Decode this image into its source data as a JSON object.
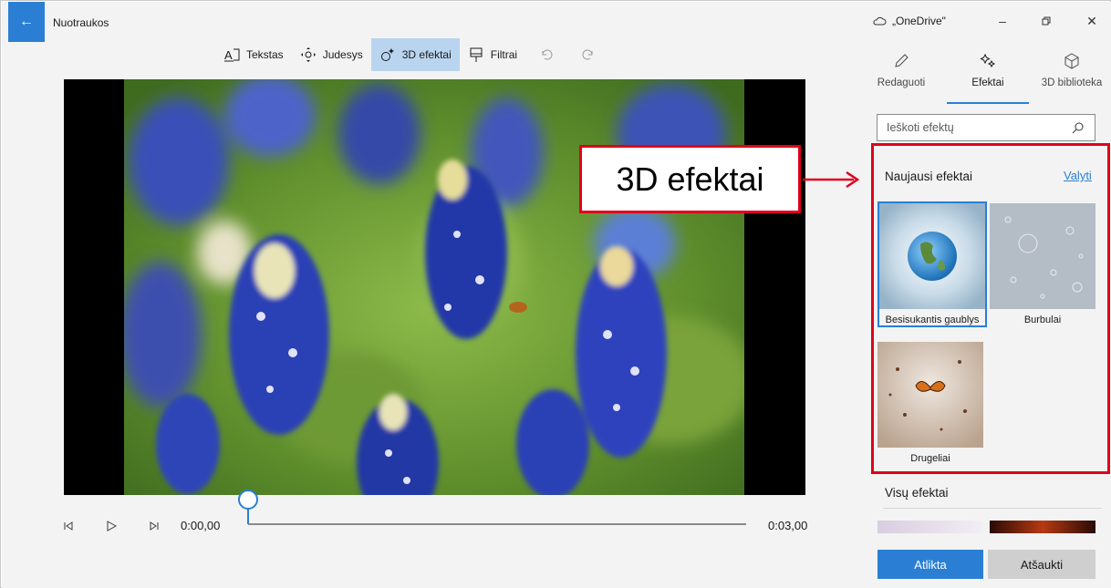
{
  "app": {
    "title": "Nuotraukos",
    "back_icon": "back-arrow-icon"
  },
  "toolbar": {
    "items": [
      {
        "label": "Tekstas",
        "icon": "text-icon"
      },
      {
        "label": "Judesys",
        "icon": "motion-icon"
      },
      {
        "label": "3D efektai",
        "icon": "3d-effects-icon",
        "active": true
      },
      {
        "label": "Filtrai",
        "icon": "filter-icon"
      }
    ],
    "undo_icon": "undo-icon",
    "redo_icon": "redo-icon"
  },
  "playback": {
    "time_current": "0:00,00",
    "time_total": "0:03,00",
    "progress": 0
  },
  "panel": {
    "title": "„OneDrive\"",
    "tabs": [
      {
        "label": "Redaguoti",
        "icon": "pencil-icon"
      },
      {
        "label": "Efektai",
        "icon": "sparkle-icon",
        "active": true
      },
      {
        "label": "3D biblioteka",
        "icon": "cube-icon"
      }
    ],
    "search_placeholder": "Ieškoti efektų",
    "recent_title": "Naujausi efektai",
    "clear_label": "Valyti",
    "effects": [
      {
        "label": "Besisukantis gaublys",
        "selected": true
      },
      {
        "label": "Burbulai"
      },
      {
        "label": "Drugeliai"
      }
    ],
    "all_title": "Visų efektai",
    "done_label": "Atlikta",
    "cancel_label": "Atšaukti"
  },
  "annotation": {
    "text": "3D efektai"
  },
  "colors": {
    "accent": "#2a7fd4",
    "highlight_red": "#e0001b",
    "panel_bg": "#f3f3f3"
  }
}
